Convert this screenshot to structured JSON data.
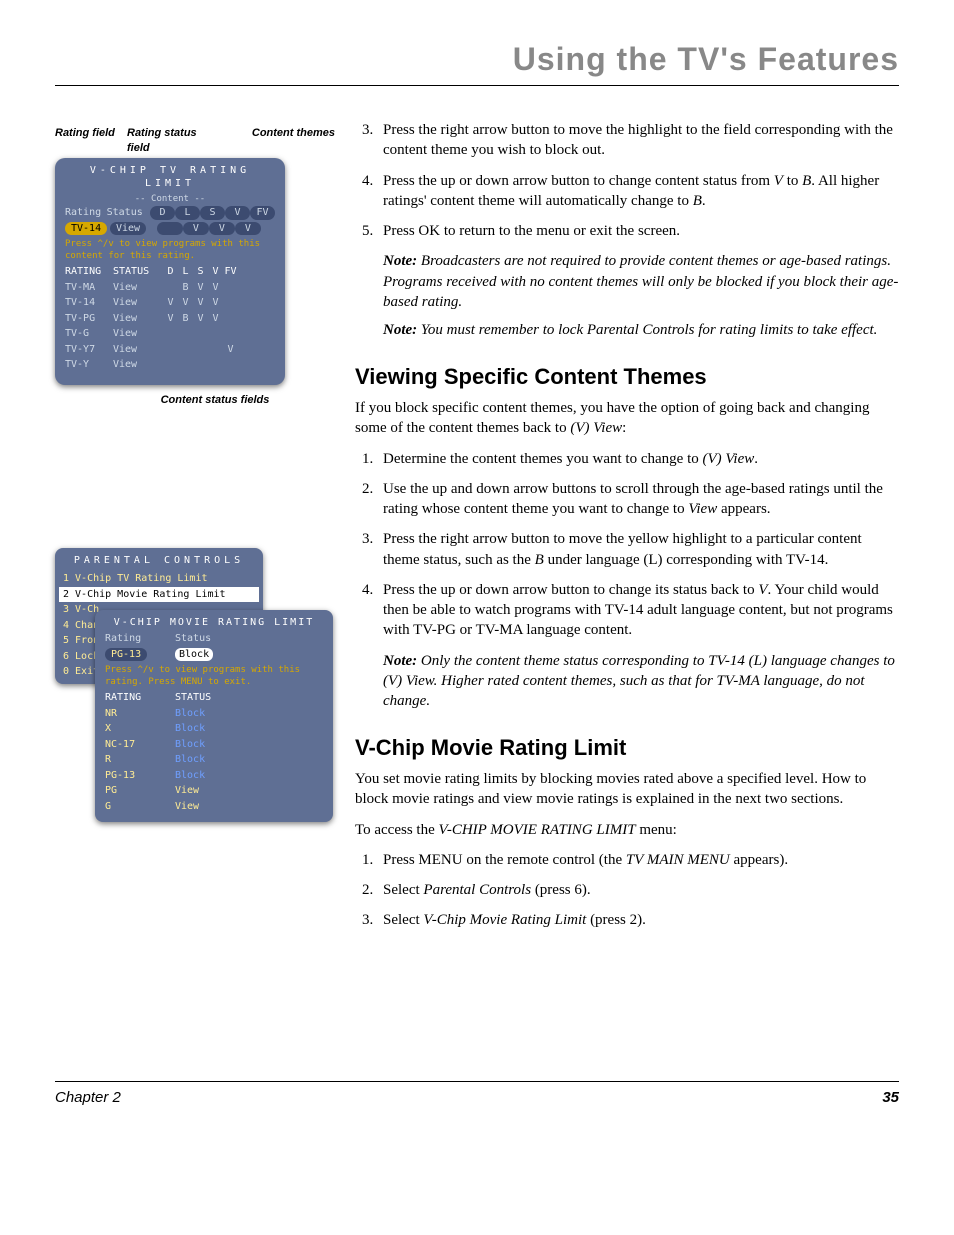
{
  "header": {
    "chapter_title": "Using the TV's Features"
  },
  "intro_steps": [
    {
      "n": "3.",
      "text_a": "Press the right arrow button to move the highlight to the field corresponding with the content theme you wish to block out."
    },
    {
      "n": "4.",
      "text_a": "Press the up or down arrow button to change content status from ",
      "i1": "V",
      "text_b": " to ",
      "i2": "B",
      "text_c": ". All higher ratings' content theme will automatically change to ",
      "i3": "B",
      "text_d": "."
    },
    {
      "n": "5.",
      "text_a": "Press OK to return to the menu or exit the screen."
    }
  ],
  "intro_notes": [
    {
      "label": "Note:",
      "text": "  Broadcasters are not required to provide content themes or age-based ratings. Programs received with no content themes will only be blocked if you block their age-based rating."
    },
    {
      "label": "Note:",
      "text": " You must remember to lock Parental Controls for rating limits to take effect."
    }
  ],
  "sec1": {
    "title": "Viewing Specific Content Themes",
    "intro_a": "If you block specific content themes, you have the option of going back and changing some of the content themes back to ",
    "intro_i": "(V) View",
    "intro_b": ":",
    "steps": [
      {
        "a": "Determine the content themes you want to change to ",
        "i": "(V) View",
        "b": "."
      },
      {
        "a": "Use the up and down arrow buttons to scroll through the age-based ratings until the rating whose content theme you want to change to ",
        "i": "View",
        "b": " appears."
      },
      {
        "a": "Press the right arrow button to move the yellow highlight to a particular content theme status, such as the ",
        "i": "B",
        "b": " under language (L) corresponding with TV-14."
      },
      {
        "a": "Press the up or down arrow button to change its status back to ",
        "i": "V",
        "b": ".  Your child would then be able to watch programs with TV-14 adult language content, but not programs with  TV-PG or TV-MA language content."
      }
    ],
    "note": {
      "label": "Note:",
      "text": "  Only the content theme status corresponding to TV-14 (L) language changes to (V) View. Higher rated content themes, such as that for TV-MA language, do not change."
    }
  },
  "sec2": {
    "title": "V-Chip Movie Rating Limit",
    "intro": "You set movie rating limits by blocking movies rated above a specified level. How to block movie ratings and view movie ratings is explained in the next two sections.",
    "access_a": "To access the ",
    "access_i": "V-CHIP MOVIE RATING LIMIT",
    "access_b": " menu:",
    "steps": [
      {
        "a": "Press MENU on the remote control (the ",
        "i": "TV MAIN MENU",
        "b": " appears)."
      },
      {
        "a": "Select ",
        "i": "Parental Controls",
        "b": " (press 6)."
      },
      {
        "a": "Select ",
        "i": "V-Chip Movie Rating Limit",
        "b": " (press 2)."
      }
    ]
  },
  "fig1": {
    "labels": {
      "rating_field": "Rating field",
      "status_field": "Rating status field",
      "themes": "Content themes",
      "bottom": "Content status fields"
    },
    "title": "V-CHIP TV RATING LIMIT",
    "dash": "-- Content --",
    "head": {
      "rating": "Rating",
      "status": "Status",
      "themes": [
        "D",
        "L",
        "S",
        "V",
        "FV"
      ]
    },
    "current": {
      "rating": "TV-14",
      "status": "View",
      "themes": [
        "",
        "V",
        "V",
        "V",
        ""
      ]
    },
    "hint": "Press ^/v to view programs with this content for this rating.",
    "tbl_head": {
      "rating": "RATING",
      "status": "STATUS",
      "themes": [
        "D",
        "L",
        "S",
        "V",
        "FV"
      ]
    },
    "rows": [
      {
        "rating": "TV-MA",
        "status": "View",
        "themes": [
          "",
          "B",
          "V",
          "V",
          ""
        ]
      },
      {
        "rating": "TV-14",
        "status": "View",
        "themes": [
          "V",
          "V",
          "V",
          "V",
          ""
        ]
      },
      {
        "rating": "TV-PG",
        "status": "View",
        "themes": [
          "V",
          "B",
          "V",
          "V",
          ""
        ]
      },
      {
        "rating": "TV-G",
        "status": "View",
        "themes": [
          "",
          "",
          "",
          "",
          ""
        ]
      },
      {
        "rating": "TV-Y7",
        "status": "View",
        "themes": [
          "",
          "",
          "",
          "",
          "V"
        ]
      },
      {
        "rating": "TV-Y",
        "status": "View",
        "themes": [
          "",
          "",
          "",
          "",
          ""
        ]
      }
    ]
  },
  "fig2": {
    "panel1": {
      "title": "PARENTAL CONTROLS",
      "items": [
        "1 V-Chip TV Rating Limit",
        "2 V-Chip Movie Rating Limit",
        "3 V-Ch",
        "4 Chan",
        "5 Fron",
        "6 Lock",
        "0 Exit"
      ],
      "selected_idx": 1
    },
    "panel2": {
      "title": "V-CHIP MOVIE RATING LIMIT",
      "head": {
        "rating": "Rating",
        "status": "Status"
      },
      "current": {
        "rating": "PG-13",
        "status": "Block"
      },
      "hint": "Press ^/v to view programs with this rating. Press MENU to exit.",
      "tbl_head": {
        "rating": "RATING",
        "status": "STATUS"
      },
      "rows": [
        {
          "rating": "NR",
          "status": "Block"
        },
        {
          "rating": "X",
          "status": "Block"
        },
        {
          "rating": "NC-17",
          "status": "Block"
        },
        {
          "rating": "R",
          "status": "Block"
        },
        {
          "rating": "PG-13",
          "status": "Block"
        },
        {
          "rating": "PG",
          "status": "View"
        },
        {
          "rating": "G",
          "status": "View"
        }
      ]
    }
  },
  "footer": {
    "chapter": "Chapter 2",
    "page": "35"
  }
}
